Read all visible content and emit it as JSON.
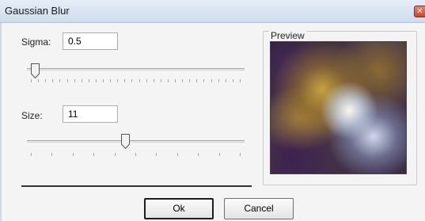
{
  "window": {
    "title": "Gaussian Blur"
  },
  "sigma": {
    "label": "Sigma:",
    "value": "0.5",
    "slider_fraction": 0.02
  },
  "size": {
    "label": "Size:",
    "value": "11",
    "slider_fraction": 0.45
  },
  "preview": {
    "label": "Preview"
  },
  "buttons": {
    "ok": "Ok",
    "cancel": "Cancel"
  }
}
